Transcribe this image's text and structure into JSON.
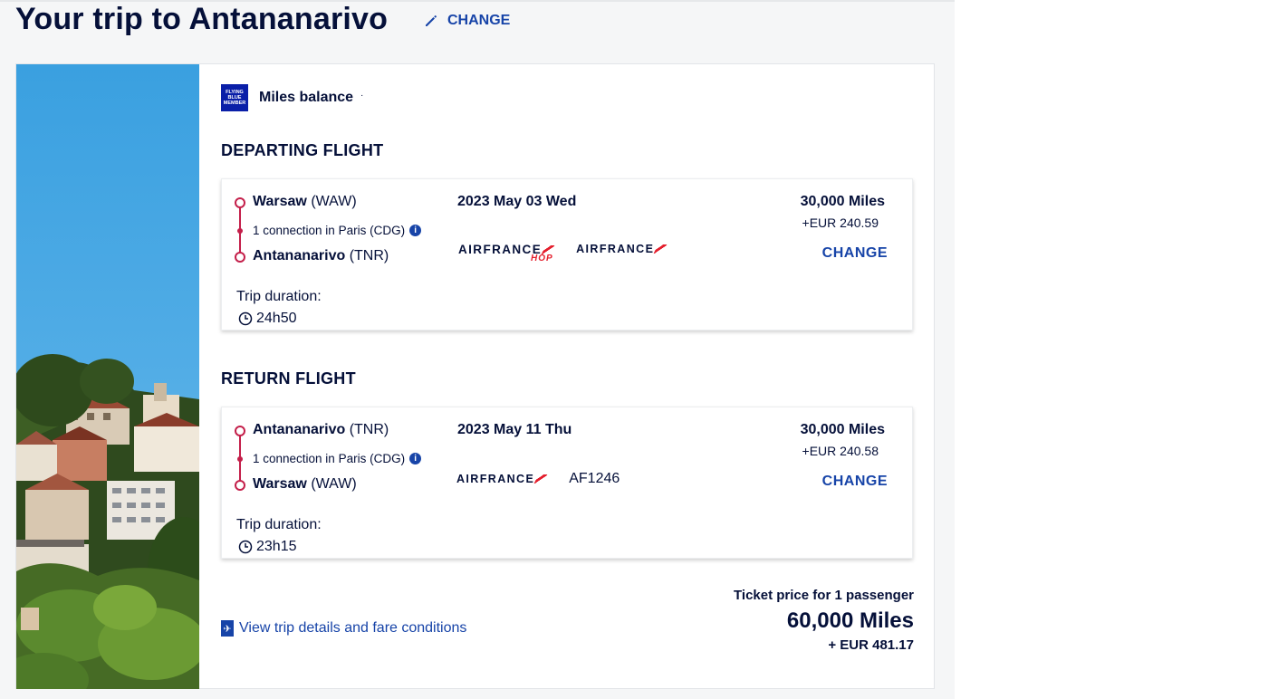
{
  "header": {
    "title": "Your trip to Antananarivo",
    "change_label": "CHANGE"
  },
  "miles": {
    "badge_lines": [
      "FLYING",
      "BLUE",
      "MEMBER"
    ],
    "label": "Miles balance",
    "value": "·"
  },
  "departing": {
    "section_title": "DEPARTING FLIGHT",
    "from_city": "Warsaw",
    "from_code": "(WAW)",
    "connection": "1 connection in Paris (CDG)",
    "to_city": "Antananarivo",
    "to_code": "(TNR)",
    "duration_label": "Trip duration:",
    "duration": "24h50",
    "date": "2023 May 03 Wed",
    "airline_1": "AIRFRANCE",
    "airline_1_sub": "HOP",
    "airline_2": "AIRFRANCE",
    "price_miles": "30,000 Miles",
    "price_eur": "+EUR 240.59",
    "change_label": "CHANGE"
  },
  "return": {
    "section_title": "RETURN FLIGHT",
    "from_city": "Antananarivo",
    "from_code": "(TNR)",
    "connection": "1 connection in Paris (CDG)",
    "to_city": "Warsaw",
    "to_code": "(WAW)",
    "duration_label": "Trip duration:",
    "duration": "23h15",
    "date": "2023 May 11 Thu",
    "airline_1": "AIRFRANCE",
    "flight_number": "AF1246",
    "price_miles": "30,000 Miles",
    "price_eur": "+EUR 240.58",
    "change_label": "CHANGE"
  },
  "footer": {
    "details_link": "View trip details and fare conditions",
    "ticket_label": "Ticket price for 1 passenger",
    "total_miles": "60,000 Miles",
    "total_eur": "+ EUR 481.17"
  },
  "colors": {
    "navy": "#051039",
    "link_blue": "#1744a8",
    "route_red": "#c41f4a",
    "airfrance_red": "#e41f2d"
  }
}
